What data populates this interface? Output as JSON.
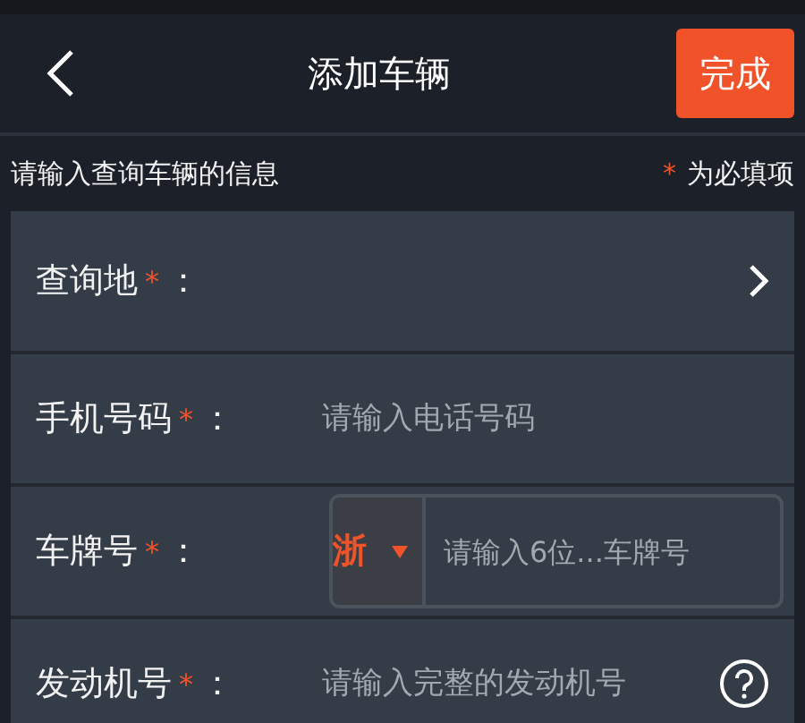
{
  "header": {
    "title": "添加车辆",
    "done_button": "完成"
  },
  "notice": {
    "text": "请输入查询车辆的信息",
    "required_mark": "*",
    "required_text": "为必填项"
  },
  "fields": [
    {
      "kind": "select",
      "label": "查询地",
      "required_mark": "*",
      "separator": "："
    },
    {
      "kind": "input",
      "label": "手机号码",
      "required_mark": "*",
      "separator": "：",
      "placeholder": "请输入电话号码"
    },
    {
      "kind": "plate",
      "label": "车牌号",
      "required_mark": "*",
      "separator": "：",
      "province": "浙",
      "placeholder": "请输入6位...车牌号"
    },
    {
      "kind": "help",
      "label": "发动机号",
      "required_mark": "*",
      "separator": "：",
      "placeholder": "请输入完整的发动机号"
    }
  ]
}
